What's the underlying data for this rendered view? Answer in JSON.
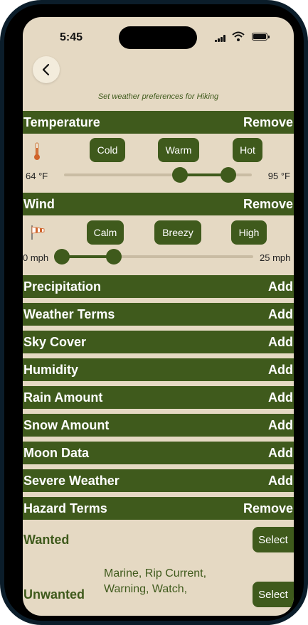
{
  "status": {
    "time": "5:45"
  },
  "header": {
    "subtitle": "Set weather preferences for Hiking"
  },
  "temperature": {
    "title": "Temperature",
    "action": "Remove",
    "options": [
      "Cold",
      "Warm",
      "Hot"
    ],
    "min_label": "64 °F",
    "max_label": "95 °F",
    "icon": "thermometer-icon"
  },
  "wind": {
    "title": "Wind",
    "action": "Remove",
    "options": [
      "Calm",
      "Breezy",
      "High"
    ],
    "min_label": "0 mph",
    "max_label": "25 mph",
    "icon": "windsock-icon"
  },
  "categories": [
    {
      "title": "Precipitation",
      "action": "Add"
    },
    {
      "title": "Weather Terms",
      "action": "Add"
    },
    {
      "title": "Sky Cover",
      "action": "Add"
    },
    {
      "title": "Humidity",
      "action": "Add"
    },
    {
      "title": "Rain Amount",
      "action": "Add"
    },
    {
      "title": "Snow Amount",
      "action": "Add"
    },
    {
      "title": "Moon Data",
      "action": "Add"
    },
    {
      "title": "Severe Weather",
      "action": "Add"
    }
  ],
  "hazard": {
    "title": "Hazard Terms",
    "action": "Remove",
    "wanted_label": "Wanted",
    "unwanted_label": "Unwanted",
    "unwanted_items": "Marine, Rip Current, Warning, Watch,",
    "select_label": "Select"
  },
  "colors": {
    "accent": "#3f5a1c",
    "background": "#e5d9c3"
  }
}
